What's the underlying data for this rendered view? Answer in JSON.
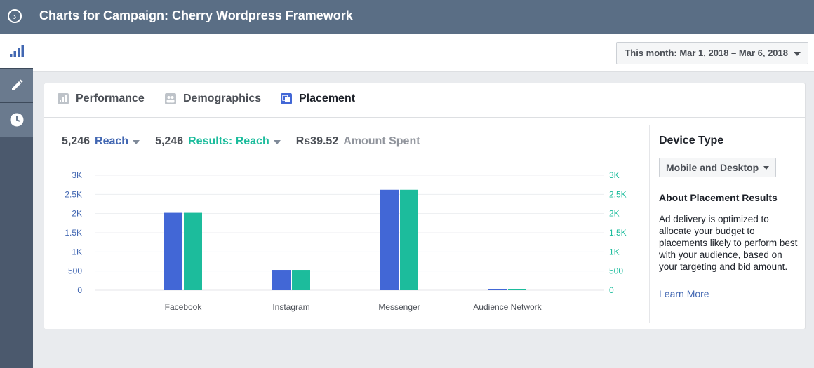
{
  "header": {
    "title": "Charts for Campaign: Cherry Wordpress Framework"
  },
  "toolbar": {
    "date_range": "This month: Mar 1, 2018 – Mar 6, 2018"
  },
  "sidebar": {
    "items": [
      {
        "icon": "bar-chart-icon",
        "active": true
      },
      {
        "icon": "pencil-icon",
        "active": false
      },
      {
        "icon": "clock-icon",
        "active": false
      }
    ]
  },
  "tabs": [
    {
      "label": "Performance",
      "icon": "performance-icon",
      "selected": false
    },
    {
      "label": "Demographics",
      "icon": "demographics-icon",
      "selected": false
    },
    {
      "label": "Placement",
      "icon": "placement-icon",
      "selected": true
    }
  ],
  "metrics": {
    "reach": {
      "value": "5,246",
      "label": "Reach",
      "color": "#4267b2"
    },
    "results": {
      "value": "5,246",
      "label": "Results: Reach",
      "color": "#1cbc9c"
    },
    "spent": {
      "value": "Rs39.52",
      "label": "Amount Spent",
      "color": "#90949c"
    }
  },
  "chart_data": {
    "type": "bar",
    "categories": [
      "Facebook",
      "Instagram",
      "Messenger",
      "Audience Network"
    ],
    "series": [
      {
        "values": [
          2020,
          530,
          2620,
          5
        ],
        "color": "#4267d6",
        "axis": "left"
      },
      {
        "values": [
          2020,
          530,
          2620,
          5
        ],
        "color": "#1cbc9c",
        "axis": "right"
      }
    ],
    "ylim": [
      0,
      3000
    ],
    "y_ticks": [
      "0",
      "500",
      "1K",
      "1.5K",
      "2K",
      "2.5K",
      "3K"
    ],
    "grid": true
  },
  "side_panel": {
    "device_type_heading": "Device Type",
    "device_value": "Mobile and Desktop",
    "about_heading": "About Placement Results",
    "about_text": "Ad delivery is optimized to allocate your budget to placements likely to perform best with your audience, based on your targeting and bid amount.",
    "learn_more": "Learn More"
  }
}
